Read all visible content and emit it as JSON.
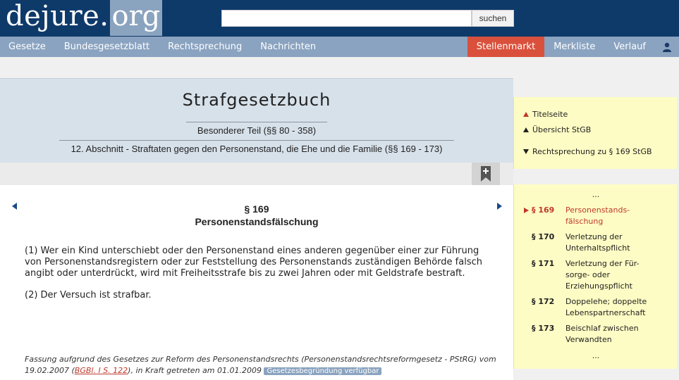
{
  "header": {
    "logo_part1": "dejure.",
    "logo_part2": "org",
    "search_placeholder": "",
    "search_button": "suchen"
  },
  "nav": {
    "items": [
      "Gesetze",
      "Bundesgesetzblatt",
      "Rechtsprechung",
      "Nachrichten"
    ],
    "right_items": [
      "Stellenmarkt",
      "Merkliste",
      "Verlauf"
    ],
    "highlight_color": "#d9513c",
    "user_icon": "user-icon"
  },
  "law": {
    "title": "Strafgesetzbuch",
    "part": "Besonderer Teil (§§ 80 - 358)",
    "section": "12. Abschnitt - Straftaten gegen den Personenstand, die Ehe und die Familie (§§ 169 - 173)"
  },
  "toolbar": {
    "bookmark_icon": "plus-bookmark-icon"
  },
  "paragraph": {
    "number": "§ 169",
    "name": "Personenstandsfälschung",
    "abs1": "(1) Wer ein Kind unterschiebt oder den Personenstand eines anderen gegenüber einer zur Führung von Personenstandsregistern oder zur Feststellung des Personenstands zuständigen Behörde falsch angibt oder unterdrückt, wird mit Freiheitsstrafe bis zu zwei Jahren oder mit Geldstrafe bestraft.",
    "abs2": "(2) Der Versuch ist strafbar.",
    "footnote_a": "Fassung aufgrund des Gesetzes zur Reform des Personenstandsrechts (Personenstandsrechtsreformgesetz - PStRG) vom 19.02.2007 (",
    "footnote_link": "BGBl. I S. 122",
    "footnote_b": "), in Kraft getreten am 01.01.2009",
    "footnote_badge": "Gesetzesbegründung verfügbar"
  },
  "sidebar": {
    "links": [
      "Titelseite",
      "Übersicht StGB",
      "Rechtsprechung zu § 169 StGB"
    ],
    "toc_dots": "...",
    "toc": [
      {
        "num": "§ 169",
        "title": "Personenstands-\nfälschung",
        "current": true
      },
      {
        "num": "§ 170",
        "title": "Verletzung der Unterhaltspflicht",
        "current": false
      },
      {
        "num": "§ 171",
        "title": "Verletzung der Für-\nsorge- oder Erziehungspflicht",
        "current": false
      },
      {
        "num": "§ 172",
        "title": "Doppelehe; doppelte Lebenspartnerschaft",
        "current": false
      },
      {
        "num": "§ 173",
        "title": "Beischlaf zwischen Verwandten",
        "current": false
      }
    ],
    "accent_color": "#c0392b"
  }
}
